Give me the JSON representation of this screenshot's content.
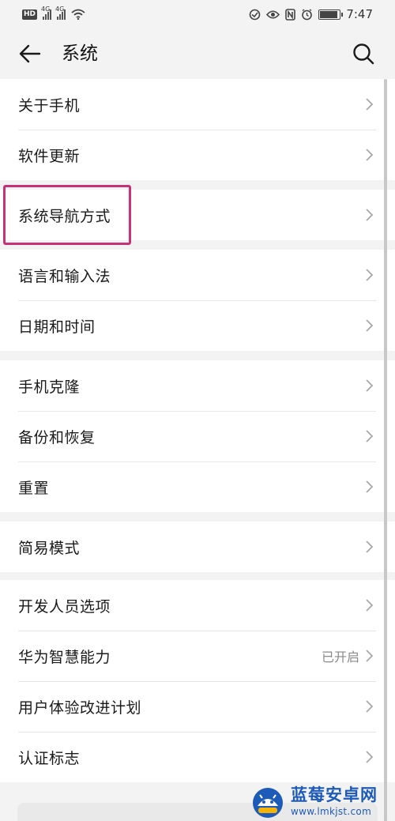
{
  "status_bar": {
    "hd": "HD",
    "net1": "4G",
    "net2": "4G",
    "time": "7:47",
    "battery_level": 0.85
  },
  "header": {
    "title": "系统",
    "back_icon": "arrow-left-icon",
    "search_icon": "search-icon"
  },
  "groups": [
    {
      "items": [
        {
          "label": "关于手机"
        },
        {
          "label": "软件更新"
        }
      ]
    },
    {
      "items": [
        {
          "label": "系统导航方式",
          "highlighted": true
        }
      ]
    },
    {
      "items": [
        {
          "label": "语言和输入法"
        },
        {
          "label": "日期和时间"
        }
      ]
    },
    {
      "items": [
        {
          "label": "手机克隆"
        },
        {
          "label": "备份和恢复"
        },
        {
          "label": "重置"
        }
      ]
    },
    {
      "items": [
        {
          "label": "简易模式"
        }
      ]
    },
    {
      "items": [
        {
          "label": "开发人员选项"
        },
        {
          "label": "华为智慧能力",
          "value": "已开启"
        },
        {
          "label": "用户体验改进计划"
        },
        {
          "label": "认证标志"
        }
      ]
    }
  ],
  "watermark": {
    "brand": "蓝莓安卓网",
    "url": "www.lmkjst.com"
  },
  "colors": {
    "highlight": "#c9307a",
    "background": "#f3f3f3",
    "watermark": "#1e5bb8"
  }
}
